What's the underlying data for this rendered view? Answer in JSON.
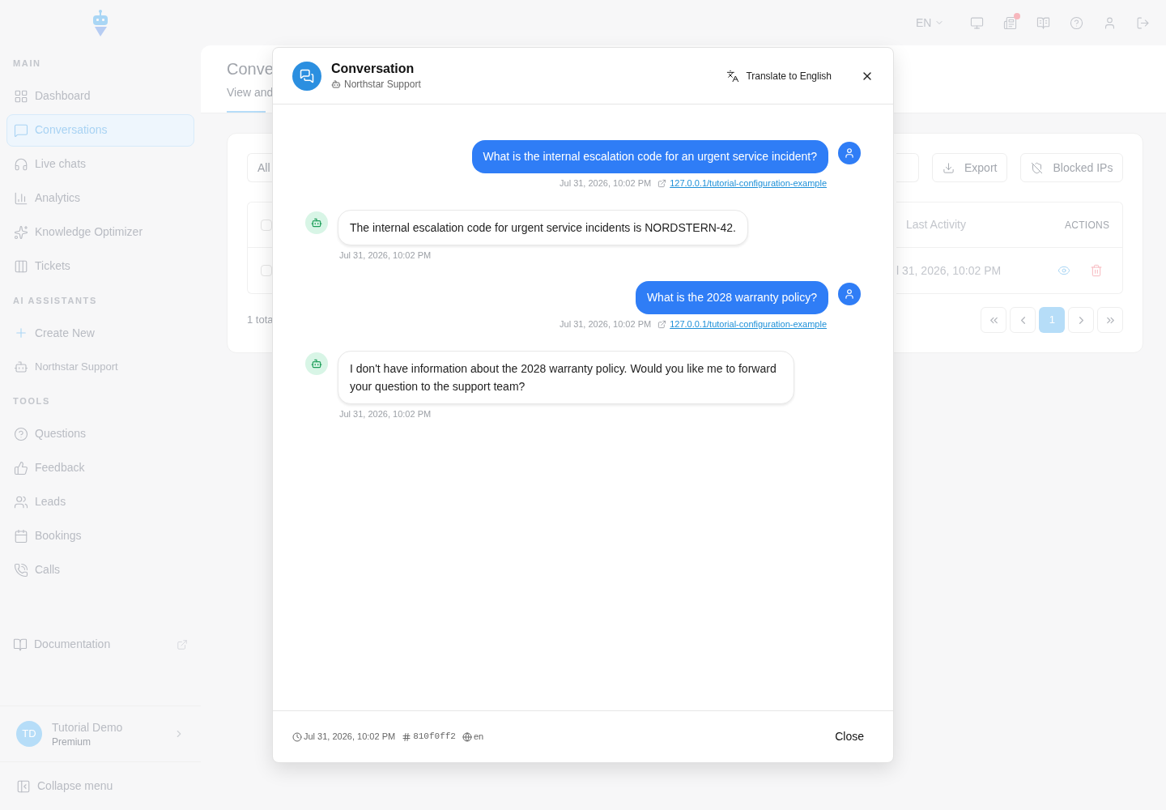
{
  "sidebar": {
    "sections": [
      {
        "title": "MAIN",
        "items": [
          {
            "label": "Dashboard",
            "selected": false
          },
          {
            "label": "Conversations",
            "selected": true
          },
          {
            "label": "Live chats",
            "selected": false
          },
          {
            "label": "Analytics",
            "selected": false
          },
          {
            "label": "Knowledge Optimizer",
            "selected": false
          },
          {
            "label": "Tickets",
            "selected": false
          }
        ]
      },
      {
        "title": "AI ASSISTANTS",
        "items": [
          {
            "label": "Create New",
            "selected": false
          },
          {
            "label": "Northstar Support",
            "selected": false
          }
        ]
      },
      {
        "title": "TOOLS",
        "items": [
          {
            "label": "Questions",
            "selected": false
          },
          {
            "label": "Feedback",
            "selected": false
          },
          {
            "label": "Leads",
            "selected": false
          },
          {
            "label": "Bookings",
            "selected": false
          },
          {
            "label": "Calls",
            "selected": false
          }
        ]
      }
    ],
    "documentation": "Documentation",
    "user": {
      "initials": "TD",
      "name": "Tutorial Demo",
      "plan": "Premium"
    },
    "collapse": "Collapse menu"
  },
  "topbar": {
    "language": "EN",
    "notification": true
  },
  "page": {
    "title": "Conve",
    "subtitle": "View and",
    "filter": "All",
    "total": "1 tota",
    "export": "Export",
    "blocked": "Blocked IPs",
    "columns": [
      "Last Activity",
      "ACTIONS"
    ],
    "header_checked": false,
    "row": {
      "checked": false,
      "last_activity": "l 31, 2026, 10:02 PM"
    },
    "pages": [
      {
        "label": "1",
        "selected": true
      }
    ]
  },
  "modal": {
    "title": "Conversation",
    "assistant": "Northstar Support",
    "translate": "Translate to English",
    "messages": [
      {
        "kind": "user",
        "text": "What is the internal escalation code for an urgent service incident?",
        "time": "Jul 31, 2026, 10:02 PM",
        "link": "127.0.0.1/tutorial-configuration-example"
      },
      {
        "kind": "bot",
        "text": "The internal escalation code for urgent service incidents is NORDSTERN-42.",
        "time": "Jul 31, 2026, 10:02 PM"
      },
      {
        "kind": "user",
        "text": "What is the 2028 warranty policy?",
        "time": "Jul 31, 2026, 10:02 PM",
        "link": "127.0.0.1/tutorial-configuration-example"
      },
      {
        "kind": "bot",
        "text": "I don't have information about the 2028 warranty policy. Would you like me to forward your question to the support team?",
        "time": "Jul 31, 2026, 10:02 PM"
      }
    ],
    "footer": {
      "time": "Jul 31, 2026, 10:02 PM",
      "id": "810f0ff2",
      "language": "en",
      "close": "Close"
    }
  }
}
